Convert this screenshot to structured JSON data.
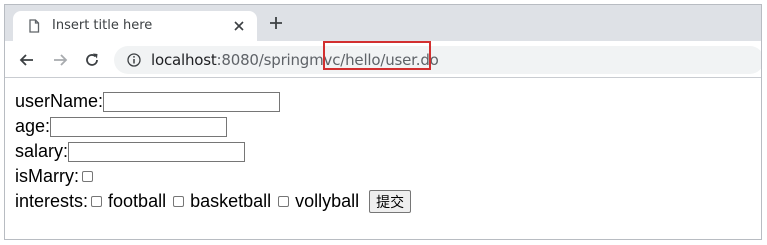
{
  "browser": {
    "tab_title": "Insert title here",
    "url_host": "localhost",
    "url_rest": ":8080/springmvc/hello/user.do",
    "highlighted_url_segment": "hello/user.do",
    "highlight_color": "#d22f2f"
  },
  "form": {
    "username_label": "userName:",
    "username_value": "",
    "age_label": "age:",
    "age_value": "",
    "salary_label": "salary:",
    "salary_value": "",
    "ismarry_label": "isMarry:",
    "interests_label": "interests:",
    "interests": [
      {
        "label": "football",
        "checked": false
      },
      {
        "label": "basketball",
        "checked": false
      },
      {
        "label": "vollyball",
        "checked": false
      }
    ],
    "submit_label": "提交"
  }
}
